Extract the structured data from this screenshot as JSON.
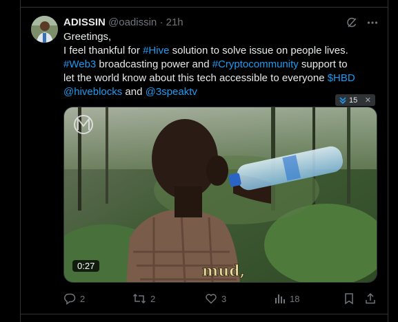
{
  "tweet": {
    "author_name": "ADISSIN",
    "author_handle": "@oadissin",
    "separator": "·",
    "time": "21h",
    "lines": [
      [
        {
          "t": "Greetings,",
          "tag": false
        }
      ],
      [
        {
          "t": "I feel thankful for ",
          "tag": false
        },
        {
          "t": "#Hive",
          "tag": true
        },
        {
          "t": " solution to solve issue on people lives.",
          "tag": false
        }
      ],
      [
        {
          "t": "#Web3",
          "tag": true
        },
        {
          "t": " broadcasting power and ",
          "tag": false
        },
        {
          "t": "#Cryptocommunity",
          "tag": true
        },
        {
          "t": " support to",
          "tag": false
        }
      ],
      [
        {
          "t": "let the world know about this tech accessible to everyone ",
          "tag": false
        },
        {
          "t": "$HBD",
          "tag": true
        }
      ],
      [
        {
          "t": "@hiveblocks",
          "tag": true
        },
        {
          "t": " and ",
          "tag": false
        },
        {
          "t": "@3speaktv",
          "tag": true
        }
      ]
    ]
  },
  "annotation": {
    "count": "15",
    "close": "✕"
  },
  "media": {
    "duration": "0:27",
    "caption": "mud,"
  },
  "actions": {
    "replies": "2",
    "reposts": "2",
    "likes": "3",
    "views": "18"
  },
  "colors": {
    "accent": "#1d9bf0",
    "muted": "#71767b",
    "text": "#e7e9ea",
    "background": "#000000"
  }
}
